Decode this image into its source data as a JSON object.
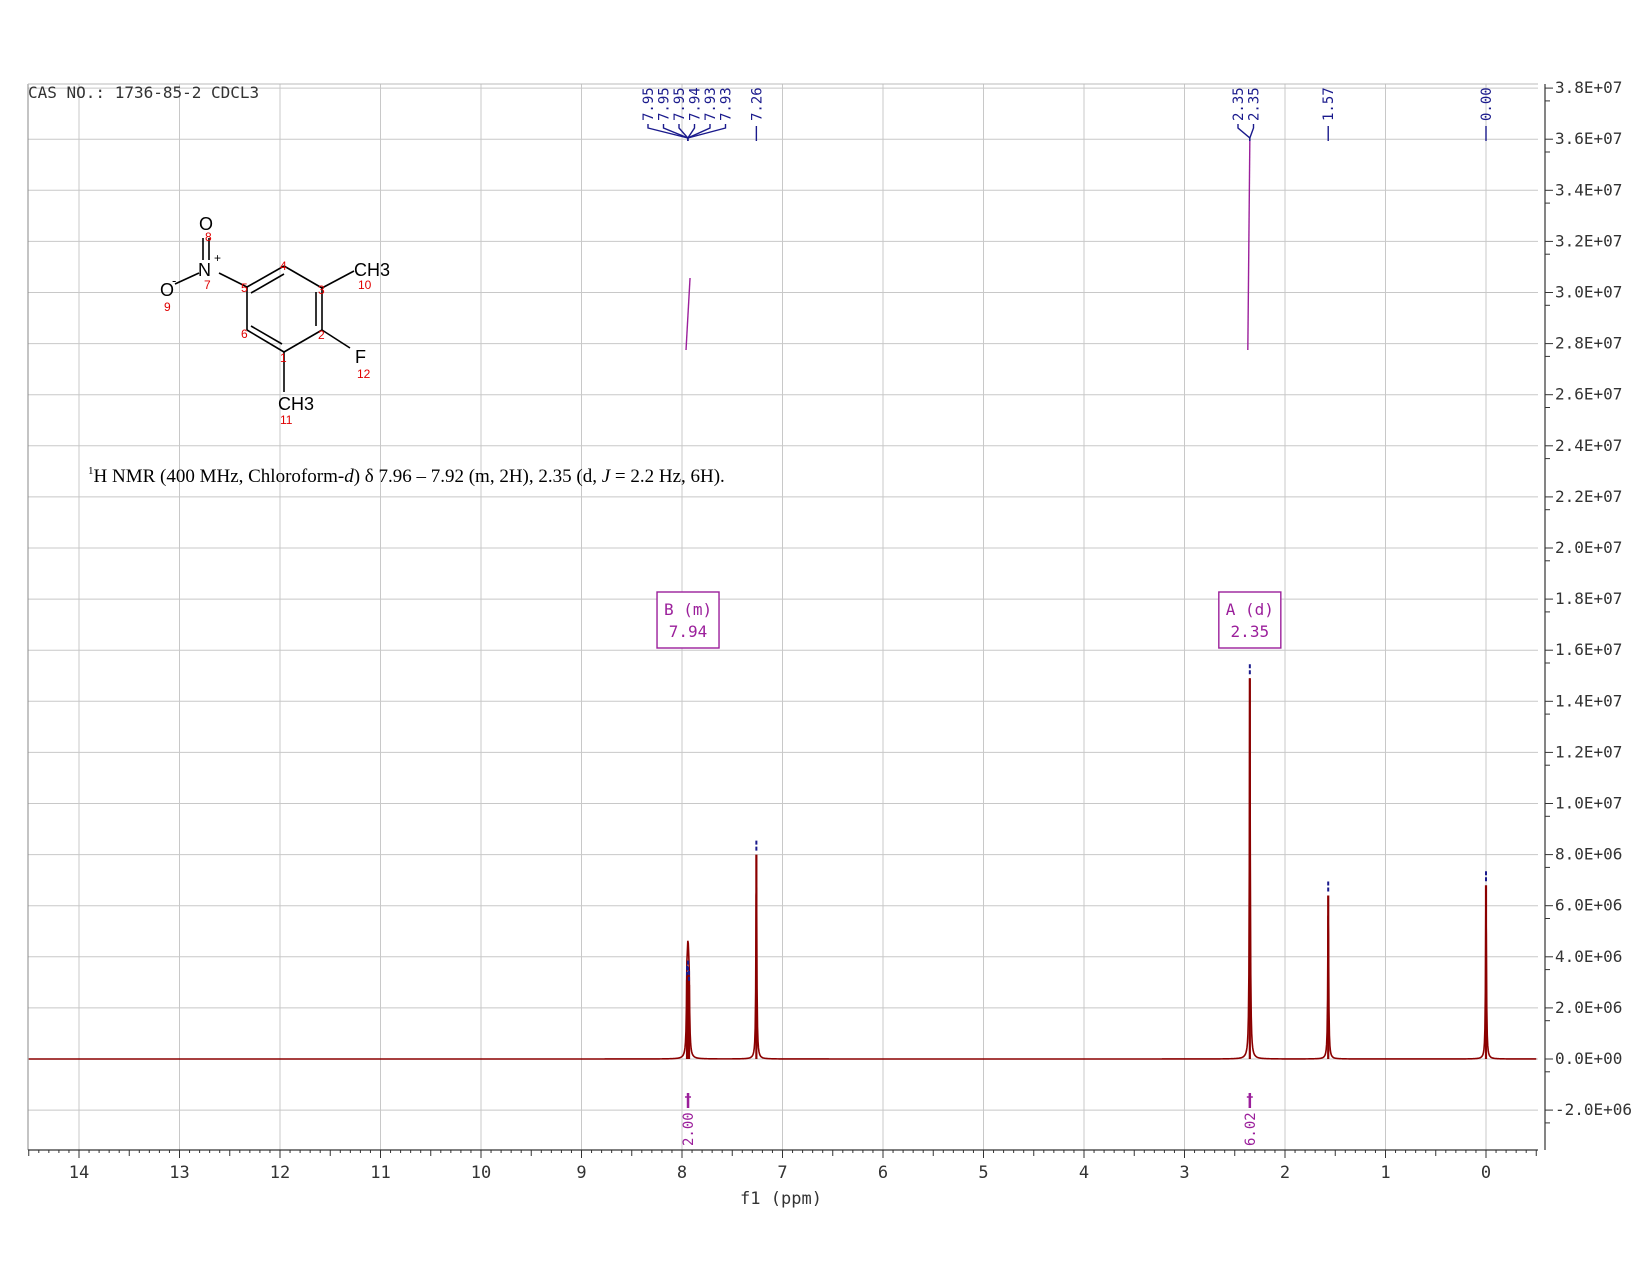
{
  "header": {
    "sample_label": "CAS NO.: 1736-85-2 CDCL3"
  },
  "description": {
    "prefix_sup": "1",
    "part1": "H NMR (400 MHz, Chloroform-",
    "italic_d": "d",
    "part2": ") δ 7.96 – 7.92 (m, 2H), 2.35 (d, ",
    "italic_J": "J",
    "part3": " = 2.2 Hz, 6H)."
  },
  "structure": {
    "atoms": [
      {
        "label": "O",
        "number": "8"
      },
      {
        "label": "N",
        "charge": "+",
        "number": "7"
      },
      {
        "label": "O",
        "charge": "-",
        "number": "9"
      },
      {
        "label": "CH3",
        "number": "10"
      },
      {
        "label": "F",
        "number": "12"
      },
      {
        "label": "CH3",
        "number": "11"
      }
    ],
    "ring_numbers": [
      "1",
      "2",
      "3",
      "4",
      "5",
      "6"
    ]
  },
  "chart_data": {
    "type": "line",
    "title": "",
    "xlabel": "f1 (ppm)",
    "ylabel": "",
    "xlim": [
      14.5,
      -0.5
    ],
    "ylim": [
      -3200000,
      38000000
    ],
    "x_ticks": [
      14,
      13,
      12,
      11,
      10,
      9,
      8,
      7,
      6,
      5,
      4,
      3,
      2,
      1,
      0
    ],
    "y_ticks": [
      {
        "value": 38000000,
        "label": "3.8E+07"
      },
      {
        "value": 36000000,
        "label": "3.6E+07"
      },
      {
        "value": 34000000,
        "label": "3.4E+07"
      },
      {
        "value": 32000000,
        "label": "3.2E+07"
      },
      {
        "value": 30000000,
        "label": "3.0E+07"
      },
      {
        "value": 28000000,
        "label": "2.8E+07"
      },
      {
        "value": 26000000,
        "label": "2.6E+07"
      },
      {
        "value": 24000000,
        "label": "2.4E+07"
      },
      {
        "value": 22000000,
        "label": "2.2E+07"
      },
      {
        "value": 20000000,
        "label": "2.0E+07"
      },
      {
        "value": 18000000,
        "label": "1.8E+07"
      },
      {
        "value": 16000000,
        "label": "1.6E+07"
      },
      {
        "value": 14000000,
        "label": "1.4E+07"
      },
      {
        "value": 12000000,
        "label": "1.2E+07"
      },
      {
        "value": 10000000,
        "label": "1.0E+07"
      },
      {
        "value": 8000000,
        "label": "8.0E+06"
      },
      {
        "value": 6000000,
        "label": "6.0E+06"
      },
      {
        "value": 4000000,
        "label": "4.0E+06"
      },
      {
        "value": 2000000,
        "label": "2.0E+06"
      },
      {
        "value": 0,
        "label": "0.0E+00"
      },
      {
        "value": -2000000,
        "label": "-2.0E+06"
      }
    ],
    "grid": true,
    "peaks": [
      {
        "ppm": 7.95,
        "intensity": 3100000
      },
      {
        "ppm": 7.94,
        "intensity": 3300000
      },
      {
        "ppm": 7.93,
        "intensity": 2900000
      },
      {
        "ppm": 7.26,
        "intensity": 8000000
      },
      {
        "ppm": 2.35,
        "intensity": 14900000
      },
      {
        "ppm": 1.57,
        "intensity": 6400000
      },
      {
        "ppm": 0.0,
        "intensity": 6800000
      }
    ],
    "peak_labels": [
      {
        "text": "7.95",
        "ppm": 7.95
      },
      {
        "text": "7.95",
        "ppm": 7.95
      },
      {
        "text": "7.95",
        "ppm": 7.95
      },
      {
        "text": "7.94",
        "ppm": 7.94
      },
      {
        "text": "7.93",
        "ppm": 7.93
      },
      {
        "text": "7.93",
        "ppm": 7.93
      },
      {
        "text": "7.26",
        "ppm": 7.26
      },
      {
        "text": "2.35",
        "ppm": 2.35
      },
      {
        "text": "2.35",
        "ppm": 2.35
      },
      {
        "text": "1.57",
        "ppm": 1.57
      },
      {
        "text": "0.00",
        "ppm": 0.0
      }
    ],
    "multiplets": [
      {
        "name": "B (m)",
        "shift": "7.94",
        "ppm": 7.94
      },
      {
        "name": "A (d)",
        "shift": "2.35",
        "ppm": 2.35
      }
    ],
    "integrals": [
      {
        "ppm": 7.94,
        "value": "2.00"
      },
      {
        "ppm": 2.35,
        "value": "6.02"
      }
    ],
    "colors": {
      "spectrum": "#8b0000",
      "peak_label": "#1a1a8c",
      "multiplet": "#9b1f9b",
      "integral": "#9b1f9b",
      "grid": "#c8c8c8",
      "atom_number": "#e00000"
    }
  }
}
